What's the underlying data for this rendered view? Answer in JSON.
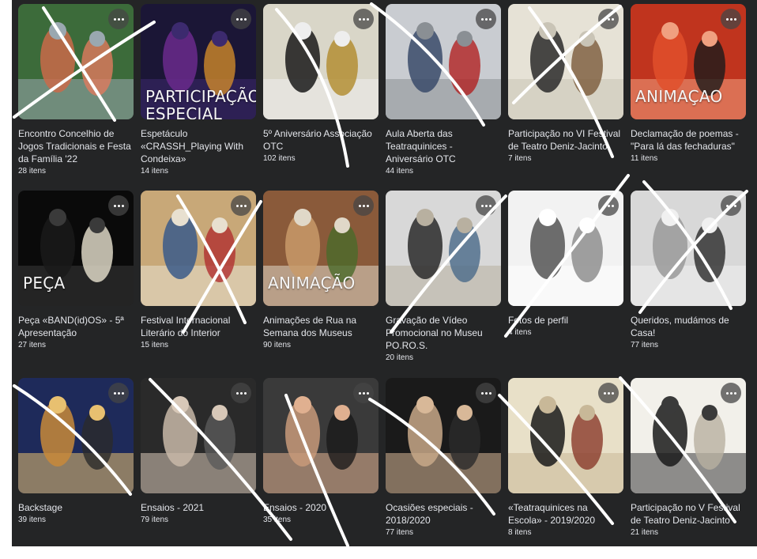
{
  "albums": [
    {
      "title": "Encontro Concelhio de Jogos Tradicionais e Festa da Família '22",
      "count": "28 itens",
      "overlay": "",
      "palette": [
        "#3c6b3a",
        "#c96a4a",
        "#e07a5f",
        "#9aa8b0"
      ]
    },
    {
      "title": "Espetáculo «CRASSH_Playing With Condeixa»",
      "count": "14 itens",
      "overlay": "PARTICIPAÇÃO ESPECIAL",
      "palette": [
        "#1b1636",
        "#6a2a8c",
        "#d08a2a",
        "#3c2a6e"
      ]
    },
    {
      "title": "5º Aniversário Associação OTC",
      "count": "102 itens",
      "overlay": "",
      "palette": [
        "#d9d6c8",
        "#1a1a1a",
        "#b08a2a",
        "#eeeeee"
      ]
    },
    {
      "title": "Aula Aberta das Teatraquinices - Aniversário OTC",
      "count": "44 itens",
      "overlay": "",
      "palette": [
        "#c9ccd1",
        "#3a4a6a",
        "#b22222",
        "#8a8f94"
      ]
    },
    {
      "title": "Participação no VI Festival de Teatro Deniz-Jacinto",
      "count": "7 itens",
      "overlay": "",
      "palette": [
        "#e6e2d6",
        "#2a2a2a",
        "#7a5a3a",
        "#c9c4b6"
      ]
    },
    {
      "title": "Declamação de poemas - \"Para lá das fechaduras\"",
      "count": "11 itens",
      "overlay": "ANIMAÇAO",
      "palette": [
        "#c0341e",
        "#e0502c",
        "#1a1a1a",
        "#f0a080"
      ]
    },
    {
      "title": "Peça «BAND(id)OS» - 5ª Apresentação",
      "count": "27 itens",
      "overlay": "PEÇA",
      "palette": [
        "#0a0a0a",
        "#1a1a1a",
        "#e8e2d0",
        "#3a3a3a"
      ]
    },
    {
      "title": "Festival Internacional Literário do Interior",
      "count": "15 itens",
      "overlay": "",
      "palette": [
        "#c8a878",
        "#3a5a8a",
        "#b03030",
        "#e8e0d0"
      ]
    },
    {
      "title": "Animações de Rua na Semana dos Museus",
      "count": "90 itens",
      "overlay": "ANIMAÇÃO",
      "palette": [
        "#8a5a3a",
        "#c89a6a",
        "#4a6a2a",
        "#e0d8c8"
      ]
    },
    {
      "title": "Gravação de Vídeo Promocional no Museu PO.RO.S.",
      "count": "20 itens",
      "overlay": "",
      "palette": [
        "#d8d8d8",
        "#2a2a2a",
        "#4a6a8a",
        "#b8b0a0"
      ]
    },
    {
      "title": "Fotos de perfil",
      "count": "4 itens",
      "overlay": "",
      "palette": [
        "#f2f2f2",
        "#555555",
        "#888888",
        "#ffffff"
      ]
    },
    {
      "title": "Queridos, mudámos de Casa!",
      "count": "77 itens",
      "overlay": "",
      "palette": [
        "#d8d8d8",
        "#9a9a9a",
        "#2a2a2a",
        "#f0f0f0"
      ]
    },
    {
      "title": "Backstage",
      "count": "39 itens",
      "overlay": "",
      "palette": [
        "#1e2a5a",
        "#c88a3a",
        "#2a2a2a",
        "#e8c070"
      ]
    },
    {
      "title": "Ensaios - 2021",
      "count": "79 itens",
      "overlay": "",
      "palette": [
        "#2a2a2a",
        "#c8b8a8",
        "#5a5a5a",
        "#d8c8b8"
      ]
    },
    {
      "title": "Ensaios - 2020",
      "count": "35 itens",
      "overlay": "",
      "palette": [
        "#3a3a3a",
        "#c89a7a",
        "#1a1a1a",
        "#e0b090"
      ]
    },
    {
      "title": "Ocasiões especiais - 2018/2020",
      "count": "77 itens",
      "overlay": "",
      "palette": [
        "#1a1a1a",
        "#c8a888",
        "#2a2a2a",
        "#d8b898"
      ]
    },
    {
      "title": "«Teatraquinices na Escola» - 2019/2020",
      "count": "8 itens",
      "overlay": "",
      "palette": [
        "#e8e0c8",
        "#1a1a1a",
        "#8a3a2a",
        "#c8b898"
      ]
    },
    {
      "title": "Participação no V Festival de Teatro Deniz-Jacinto",
      "count": "21 itens",
      "overlay": "",
      "palette": [
        "#f2f0ea",
        "#1a1a1a",
        "#b8b0a0",
        "#3a3a3a"
      ]
    }
  ],
  "more_icon": "more-horizontal-icon"
}
